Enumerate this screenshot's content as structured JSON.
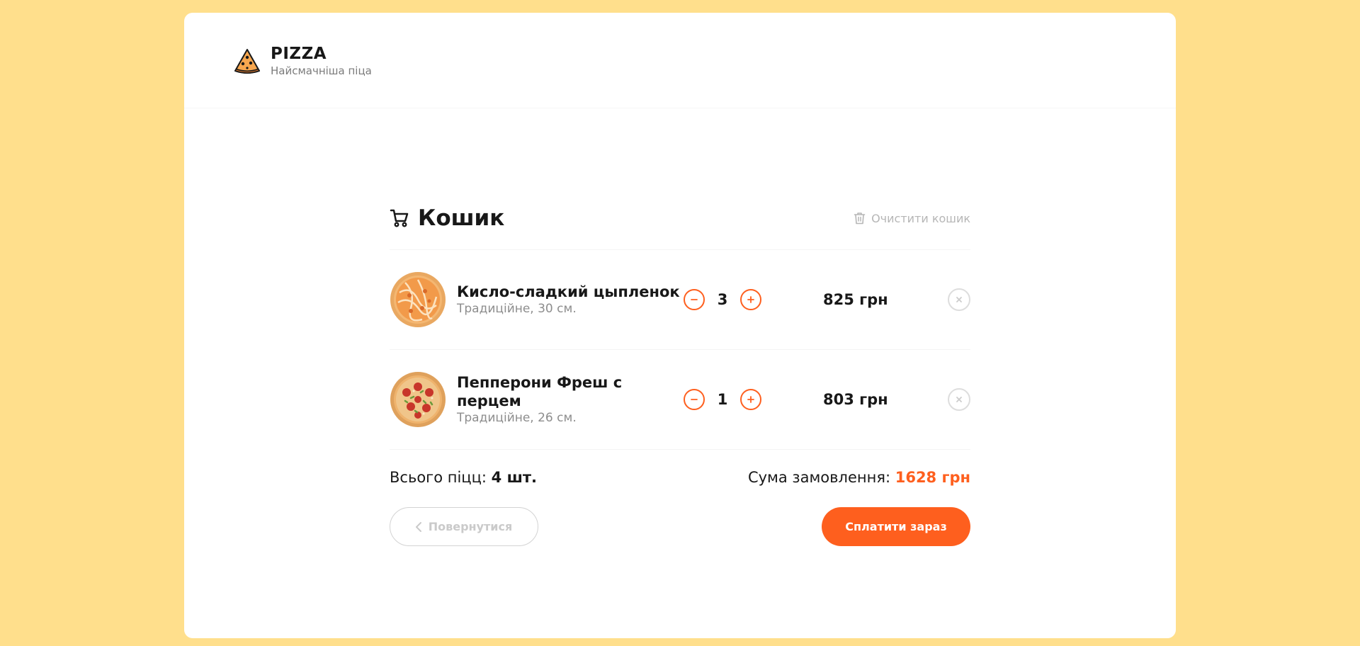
{
  "header": {
    "logo_title": "PIZZA",
    "logo_subtitle": "Найсмачніша піца"
  },
  "cart": {
    "title": "Кошик",
    "clear_label": "Очистити кошик",
    "items": [
      {
        "name": "Кисло-сладкий цыпленок",
        "details": "Традиційне, 30 см.",
        "count": "3",
        "price": "825 грн",
        "image": "pizza-chicken"
      },
      {
        "name": "Пепперони Фреш с перцем",
        "details": "Традиційне, 26 см.",
        "count": "1",
        "price": "803 грн",
        "image": "pizza-pepperoni"
      }
    ],
    "total_count_label": "Всього піцц:",
    "total_count_value": "4 шт.",
    "total_sum_label": "Сума замовлення:",
    "total_sum_value": "1628 грн",
    "back_label": "Повернутися",
    "pay_label": "Сплатити зараз"
  },
  "colors": {
    "background": "#FFDF8C",
    "accent": "#FE5F1E",
    "text": "#181818",
    "muted": "#8D8D8D"
  },
  "icons": {
    "logo": "pizza-slice-icon",
    "cart": "cart-icon",
    "trash": "trash-icon",
    "minus": "minus-icon",
    "plus": "plus-icon",
    "remove": "close-icon",
    "back": "chevron-left-icon"
  }
}
